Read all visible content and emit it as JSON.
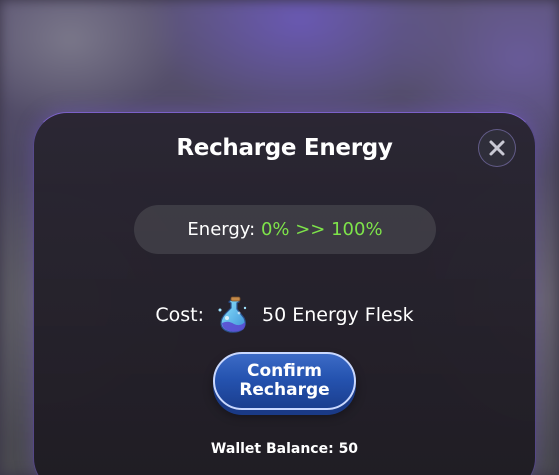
{
  "dialog": {
    "title": "Recharge Energy",
    "close_icon": "close-icon"
  },
  "energy": {
    "label": "Energy:",
    "value": "0% >> 100%",
    "value_color": "#7ee34a"
  },
  "cost": {
    "label": "Cost:",
    "item_icon": "energy-flask-icon",
    "amount_text": "50 Energy Flesk"
  },
  "confirm_button": {
    "line1": "Confirm",
    "line2": "Recharge"
  },
  "wallet": {
    "text": "Wallet Balance: 50"
  },
  "colors": {
    "accent_blue": "#2553b0",
    "modal_border": "#8c6ee6"
  }
}
